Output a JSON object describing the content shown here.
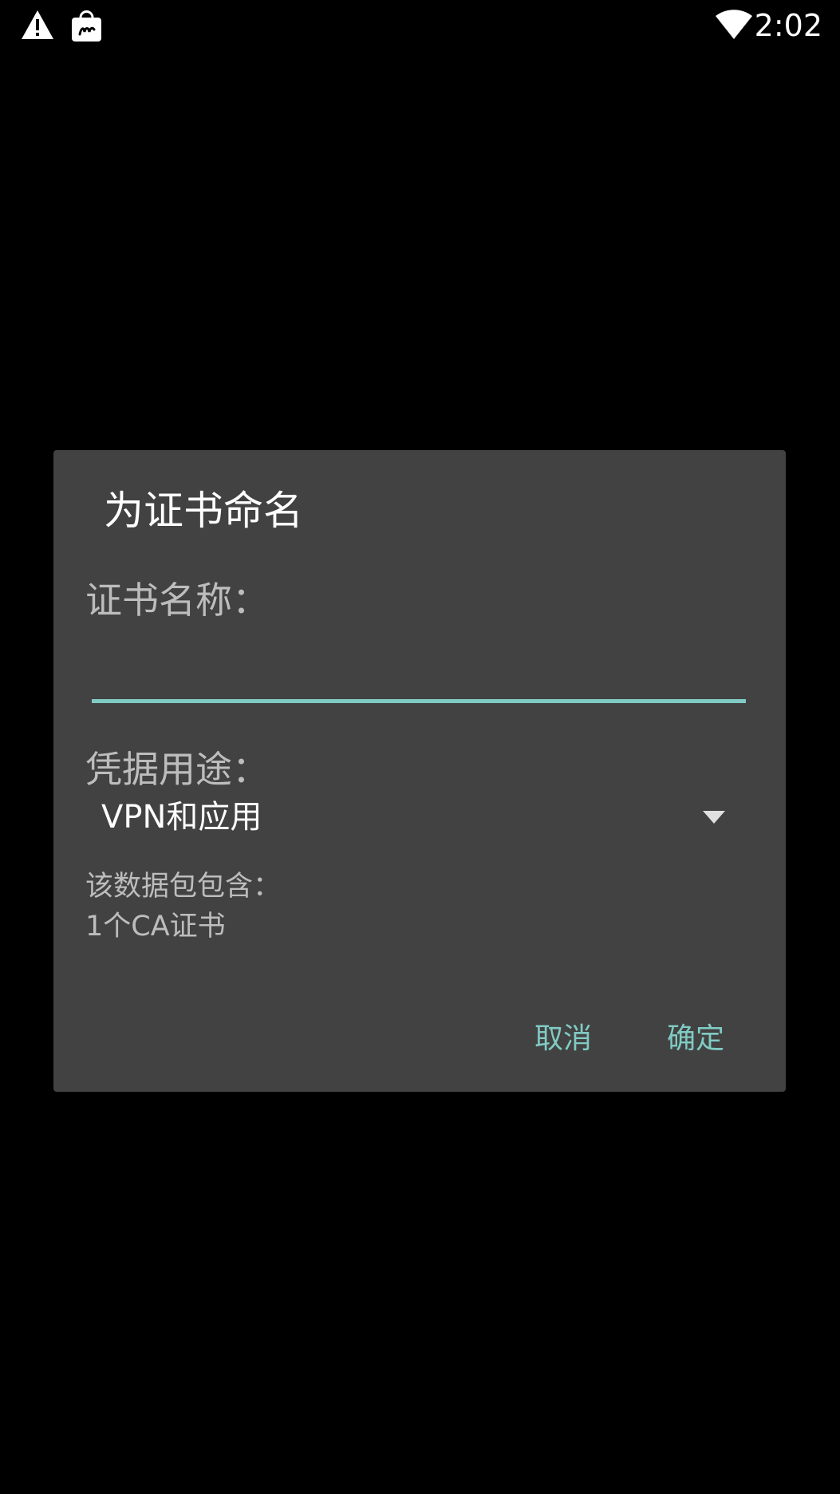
{
  "status_bar": {
    "time": "2:02",
    "icons": [
      "warning-icon",
      "store-icon",
      "wifi-icon"
    ]
  },
  "dialog": {
    "title": "为证书命名",
    "name_label": "证书名称：",
    "name_value": "",
    "usage_label": "凭据用途：",
    "usage_selected": "VPN和应用",
    "info_line_1": "该数据包包含：",
    "info_line_2": "1个CA证书",
    "cancel_label": "取消",
    "ok_label": "确定"
  },
  "colors": {
    "background": "#000000",
    "dialog": "#424242",
    "accent": "#80cbc4",
    "secondary_text": "#bdbdbd"
  }
}
